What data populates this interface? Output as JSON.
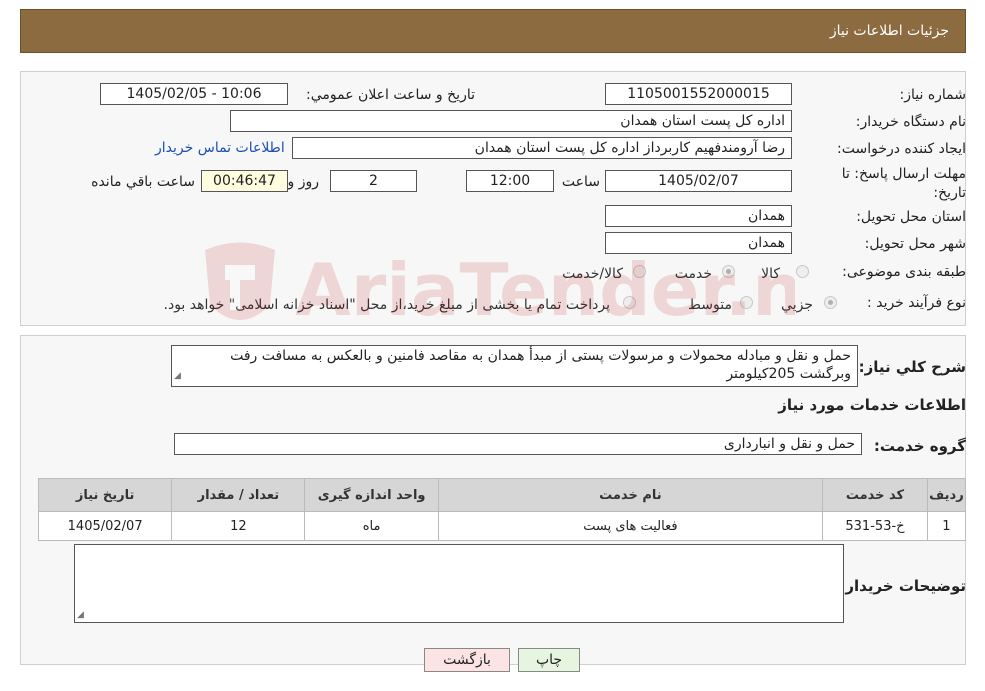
{
  "header": {
    "title": "جزئیات اطلاعات نیاز"
  },
  "fields": {
    "need_number_label": "شماره نیاز:",
    "need_number": "1105001552000015",
    "announce_label": "تاریخ و ساعت اعلان عمومي:",
    "announce_value": "1405/02/05 - 10:06",
    "buyer_org_label": "نام دستگاه خريدار:",
    "buyer_org": "اداره کل پست استان همدان",
    "requester_label": "ايجاد کننده درخواست:",
    "requester": "رضا آرومندفهیم کاربرداز اداره کل پست استان همدان",
    "contact_link": "اطلاعات تماس خريدار",
    "deadline_label": "مهلت ارسال پاسخ: تا تاريخ:",
    "deadline_date": "1405/02/07",
    "time_label": "ساعت",
    "deadline_time": "12:00",
    "days_value": "2",
    "days_label": "روز و",
    "remaining_time": "00:46:47",
    "remaining_label": "ساعت باقي مانده",
    "province_label": "استان محل تحويل:",
    "province": "همدان",
    "city_label": "شهر محل تحويل:",
    "city": "همدان",
    "category_label": "طبقه بندی موضوعی:",
    "category_options": [
      "کالا",
      "خدمت",
      "کالا/خدمت"
    ],
    "process_label": "نوع فرآيند خريد :",
    "process_options": [
      "جزيي",
      "متوسط"
    ],
    "process_note": "پرداخت تمام يا بخشی از مبلغ خريد،از محل \"اسناد خزانه اسلامی\" خواهد بود."
  },
  "summary": {
    "label": "شرح كلي نياز:",
    "text": "حمل و نقل و مبادله محمولات و مرسولات پستی از مبدأ همدان  به مقاصد فامنین  و بالعکس به مسافت رفت وبرگشت 205کیلومتر",
    "services_heading": "اطلاعات خدمات مورد نياز",
    "service_group_label": "گروه خدمت:",
    "service_group": "حمل و نقل و انبارداری"
  },
  "table": {
    "headers": [
      "رديف",
      "كد خدمت",
      "نام خدمت",
      "واحد اندازه گيری",
      "تعداد / مقدار",
      "تاريخ نياز"
    ],
    "rows": [
      [
        "1",
        "خ-53-531",
        "فعاليت های پست",
        "ماه",
        "12",
        "1405/02/07"
      ]
    ]
  },
  "buyer_notes": {
    "label": "توضيحات خريدار:",
    "text": ""
  },
  "buttons": {
    "print": "چاپ",
    "back": "بازگشت"
  },
  "watermark": {
    "text": "AriaTender.neT"
  },
  "colors": {
    "header_bg": "#8b6b3f",
    "link": "#1a4fb4",
    "back_btn": "#fde4e4",
    "print_btn": "#e6f5df"
  }
}
